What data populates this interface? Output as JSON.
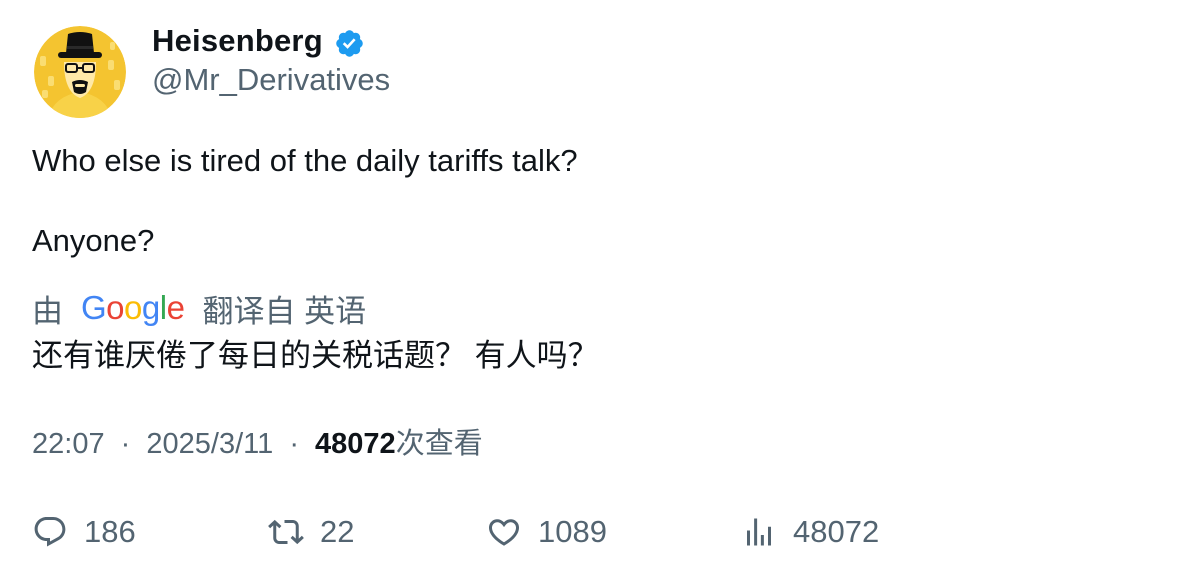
{
  "author": {
    "display_name": "Heisenberg",
    "handle": "@Mr_Derivatives",
    "verified_icon": "verified-badge-icon",
    "avatar_icon": "heisenberg-avatar",
    "colors": {
      "avatar_bg": "#f4c430",
      "verified": "#1d9bf0"
    }
  },
  "tweet": {
    "lines": [
      "Who else is tired of the daily tariffs talk?",
      "Anyone?"
    ]
  },
  "translation": {
    "prefix": "由",
    "provider": "Google",
    "suffix": "翻译自 英语",
    "text": "还有谁厌倦了每日的关税话题？ 有人吗？"
  },
  "meta": {
    "time": "22:07",
    "separator": "·",
    "date": "2025/3/11",
    "views_count": "48072",
    "views_label": "次查看"
  },
  "actions": {
    "replies": "186",
    "retweets": "22",
    "likes": "1089",
    "views": "48072"
  },
  "colors": {
    "text": "#0f1419",
    "muted": "#536471",
    "google_blue": "#4285F4",
    "google_red": "#EA4335",
    "google_yellow": "#FBBC05",
    "google_green": "#34A853"
  }
}
